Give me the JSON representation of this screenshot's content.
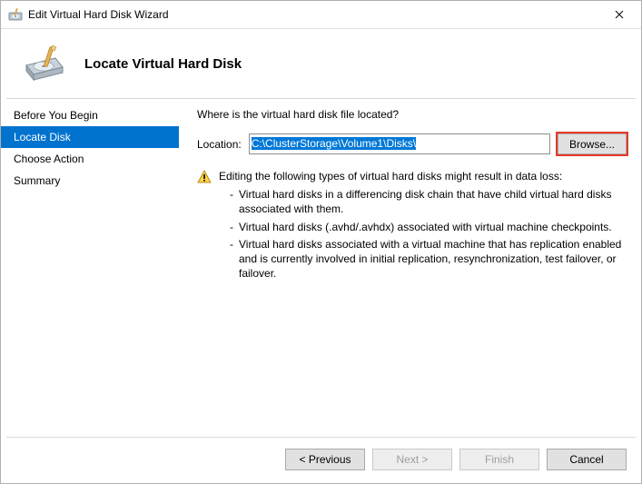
{
  "window": {
    "title": "Edit Virtual Hard Disk Wizard"
  },
  "header": {
    "title": "Locate Virtual Hard Disk"
  },
  "sidebar": {
    "items": [
      {
        "label": "Before You Begin",
        "selected": false
      },
      {
        "label": "Locate Disk",
        "selected": true
      },
      {
        "label": "Choose Action",
        "selected": false
      },
      {
        "label": "Summary",
        "selected": false
      }
    ]
  },
  "content": {
    "question": "Where is the virtual hard disk file located?",
    "location_label": "Location:",
    "location_value": "C:\\ClusterStorage\\Volume1\\Disks\\",
    "browse_label": "Browse...",
    "warning_heading": "Editing the following types of virtual hard disks might result in data loss:",
    "warning_items": [
      "Virtual hard disks in a differencing disk chain that have child virtual hard disks associated with them.",
      "Virtual hard disks (.avhd/.avhdx) associated with virtual machine checkpoints.",
      "Virtual hard disks associated with a virtual machine that has replication enabled and is currently involved in initial replication, resynchronization, test failover, or failover."
    ]
  },
  "footer": {
    "previous": "< Previous",
    "next": "Next >",
    "finish": "Finish",
    "cancel": "Cancel"
  }
}
